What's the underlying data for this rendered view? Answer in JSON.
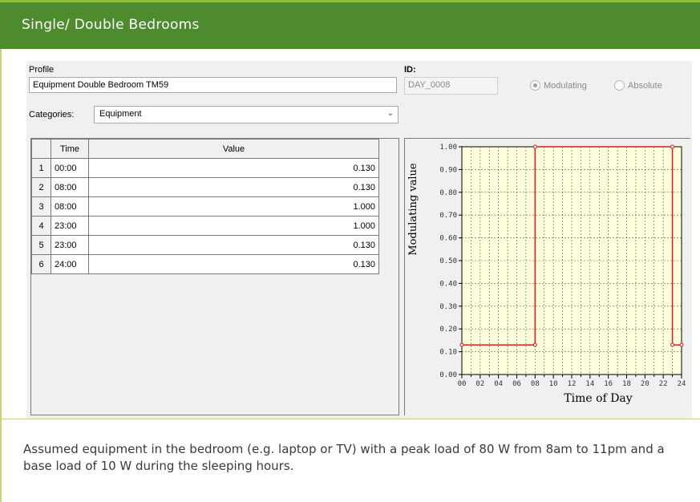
{
  "header": {
    "title": "Single/ Double Bedrooms"
  },
  "form": {
    "profile_label": "Profile",
    "profile_value": "Equipment Double Bedroom TM59",
    "id_label": "ID:",
    "id_value": "DAY_0008",
    "radio_modulating": "Modulating",
    "radio_absolute": "Absolute",
    "radio_selected": "Modulating",
    "categories_label": "Categories:",
    "categories_value": "Equipment"
  },
  "table": {
    "headers": [
      "",
      "Time",
      "Value"
    ],
    "rows": [
      {
        "n": "1",
        "time": "00:00",
        "value": "0.130"
      },
      {
        "n": "2",
        "time": "08:00",
        "value": "0.130"
      },
      {
        "n": "3",
        "time": "08:00",
        "value": "1.000"
      },
      {
        "n": "4",
        "time": "23:00",
        "value": "1.000"
      },
      {
        "n": "5",
        "time": "23:00",
        "value": "0.130"
      },
      {
        "n": "6",
        "time": "24:00",
        "value": "0.130"
      }
    ]
  },
  "chart_data": {
    "type": "line",
    "ylabel": "Modulating value",
    "xlabel": "Time of Day",
    "x": [
      0,
      8,
      8,
      23,
      23,
      24
    ],
    "y": [
      0.13,
      0.13,
      1.0,
      1.0,
      0.13,
      0.13
    ],
    "xlim": [
      0,
      24
    ],
    "ylim": [
      0,
      1
    ],
    "xticks": [
      "00",
      "02",
      "04",
      "06",
      "08",
      "10",
      "12",
      "14",
      "16",
      "18",
      "20",
      "22",
      "24"
    ],
    "yticks": [
      "0.00",
      "0.10",
      "0.20",
      "0.30",
      "0.40",
      "0.50",
      "0.60",
      "0.70",
      "0.80",
      "0.90",
      "1.00"
    ],
    "grid": true,
    "line_color": "#e01a1a",
    "plot_background": "#ffffdc"
  },
  "description": "Assumed equipment in the bedroom (e.g. laptop or TV) with a peak load of 80 W from 8am to 11pm and a base load of 10 W during the sleeping hours."
}
